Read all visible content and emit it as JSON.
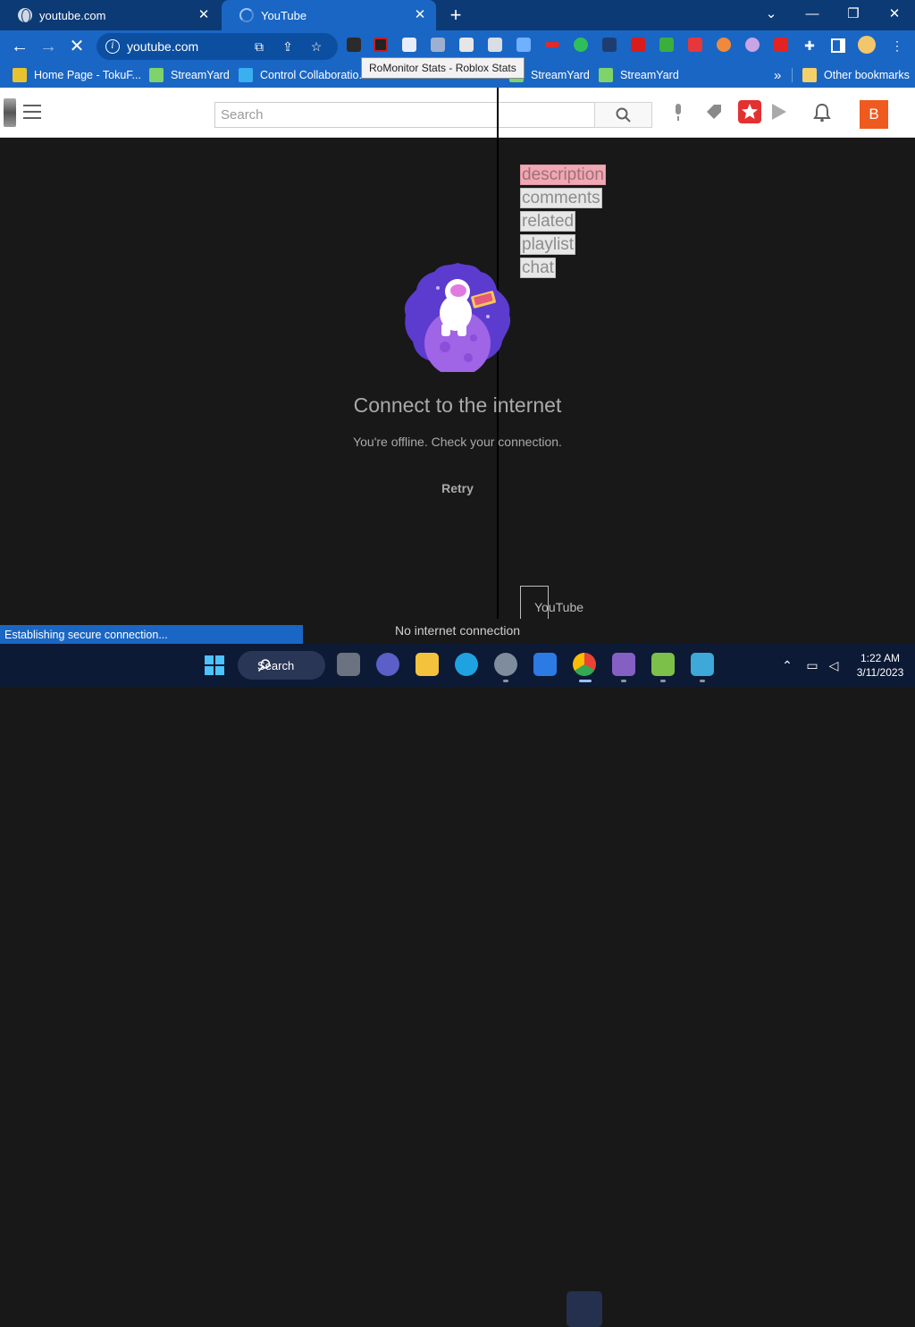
{
  "colors": {
    "tab_strip": "#0c3a75",
    "toolbar": "#1a66c4",
    "youtube_dark_bg": "#181818",
    "youtube_avatar": "#ef5a1f",
    "taskbar": "#0d1a35",
    "highlight_description": "#f0a8b4"
  },
  "browser": {
    "tabs": [
      {
        "title": "youtube.com",
        "icon": "globe-icon",
        "active": false
      },
      {
        "title": "YouTube",
        "icon": "loading-spinner-icon",
        "active": true
      }
    ],
    "new_tab_label": "+",
    "window_controls": {
      "dropdown": "⌄",
      "minimize": "—",
      "restore": "❐",
      "close": "✕"
    },
    "toolbar": {
      "back": "←",
      "forward": "→",
      "stop": "✕",
      "address": "youtube.com"
    },
    "tooltip": "RoMonitor Stats - Roblox Stats",
    "bookmarks": [
      {
        "label": "Home Page - TokuF...",
        "icon": "toku-icon"
      },
      {
        "label": "StreamYard",
        "icon": "streamyard-icon"
      },
      {
        "label": "Control Collaboratio...",
        "icon": "monitor-icon"
      },
      {
        "label": "StreamYard",
        "icon": "streamyard-icon"
      },
      {
        "label": "StreamYard",
        "icon": "streamyard-icon"
      }
    ],
    "bookmarks_overflow": "»",
    "other_bookmarks": "Other bookmarks"
  },
  "youtube": {
    "search_placeholder": "Search",
    "avatar_letter": "B",
    "sidebar_tags": [
      "description",
      "comments",
      "related",
      "playlist",
      "chat"
    ],
    "offline": {
      "title": "Connect to the internet",
      "subtitle": "You're offline. Check your connection.",
      "retry": "Retry"
    },
    "bottom_label": "YouTube"
  },
  "status": {
    "loading": "Establishing secure connection...",
    "offline_bar": "No internet connection"
  },
  "taskbar": {
    "search_label": "Search",
    "time": "1:22 AM",
    "date": "3/11/2023"
  }
}
